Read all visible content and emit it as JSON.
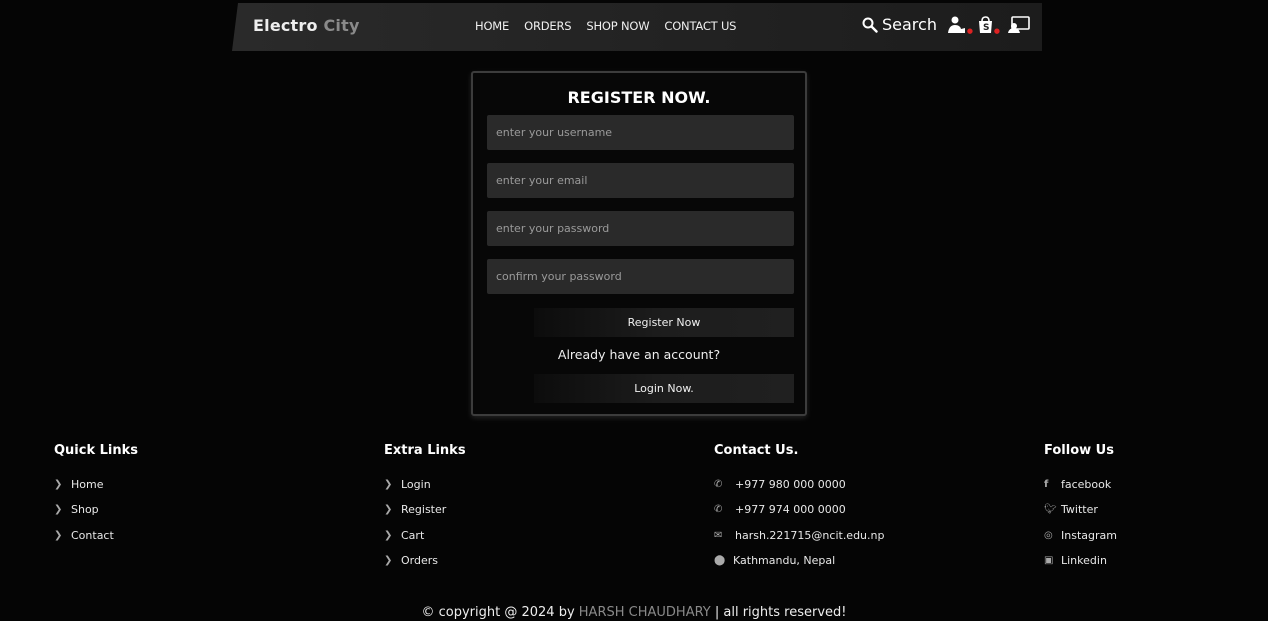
{
  "header": {
    "logo_main": "Electro",
    "logo_accent": "City",
    "nav": [
      "HOME",
      "ORDERS",
      "SHOP NOW",
      "CONTACT US"
    ],
    "search_label": "Search",
    "icons": [
      "search-icon",
      "wishlist-icon",
      "cart-icon",
      "user-icon"
    ]
  },
  "form": {
    "title": "REGISTER NOW.",
    "username_placeholder": "enter your username",
    "email_placeholder": "enter your email",
    "password_placeholder": "enter your password",
    "confirm_placeholder": "confirm your password",
    "register_button": "Register Now",
    "already_text": "Already have an account?",
    "login_button": "Login Now."
  },
  "footer": {
    "quick_links": {
      "title": "Quick Links",
      "items": [
        "Home",
        "Shop",
        "Contact"
      ]
    },
    "extra_links": {
      "title": "Extra Links",
      "items": [
        "Login",
        "Register",
        "Cart",
        "Orders"
      ]
    },
    "contact": {
      "title": "Contact Us.",
      "items": [
        "+977 980 000 0000",
        "+977 974 000 0000",
        "harsh.221715@ncit.edu.np",
        "Kathmandu, Nepal"
      ]
    },
    "follow": {
      "title": "Follow Us",
      "items": [
        "facebook",
        "Twitter",
        "Instagram",
        "Linkedin"
      ]
    },
    "copyright_prefix": "© copyright @ 2024 by",
    "copyright_name": "HARSH CHAUDHARY",
    "copyright_suffix": "| all rights reserved!"
  },
  "colors": {
    "background": "#050505",
    "header": "#222222",
    "input": "#2a2a2a",
    "accent_gray": "#8a8a8a"
  }
}
